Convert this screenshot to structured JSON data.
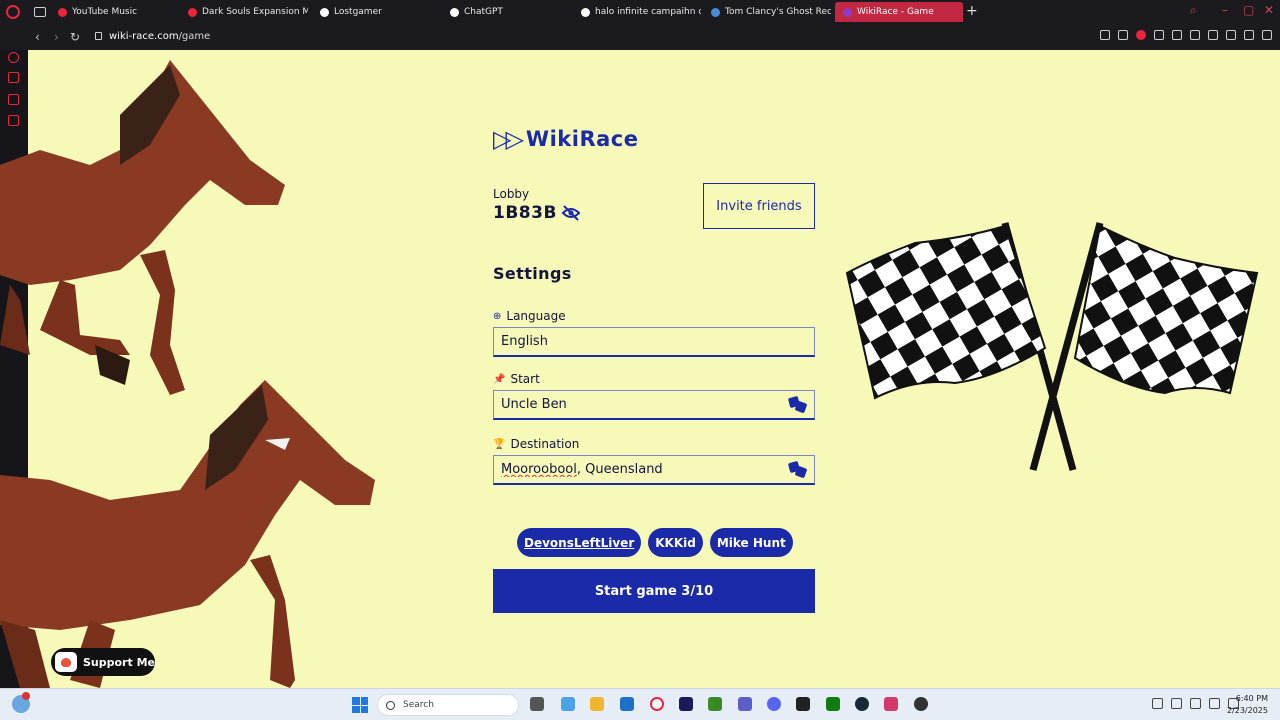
{
  "browser": {
    "tabs": [
      {
        "label": "YouTube Music",
        "color": "#e8263c"
      },
      {
        "label": "Dark Souls Expansion MOD",
        "color": "#e8263c"
      },
      {
        "label": "Lostgamer",
        "color": "#ffffff"
      },
      {
        "label": "ChatGPT",
        "color": "#ffffff"
      },
      {
        "label": "halo infinite campaihn co",
        "color": "#ffffff"
      },
      {
        "label": "Tom Clancy's Ghost Recon",
        "color": "#4a8ad8"
      },
      {
        "label": "WikiRace - Game",
        "color": "#8a3cc8"
      }
    ],
    "url_domain": "wiki-race.com",
    "url_path": "/game"
  },
  "app": {
    "name": "WikiRace",
    "lobby_label": "Lobby",
    "lobby_code": "1B83B",
    "invite_label": "Invite friends",
    "settings_title": "Settings",
    "language_label": "Language",
    "language_value": "English",
    "start_label": "Start",
    "start_value": "Uncle Ben",
    "destination_label": "Destination",
    "destination_value_part1": "Mooroobool",
    "destination_value_part2": ", Queensland",
    "players": [
      "DevonsLeftLiver",
      "KKKid",
      "Mike Hunt"
    ],
    "start_button": "Start game 3/10",
    "support_label": "Support Me",
    "accent_color": "#1a2aa8",
    "background_color": "#f6f9b8"
  },
  "taskbar": {
    "search_placeholder": "Search",
    "time": "6:40 PM",
    "date": "2/23/2025"
  }
}
